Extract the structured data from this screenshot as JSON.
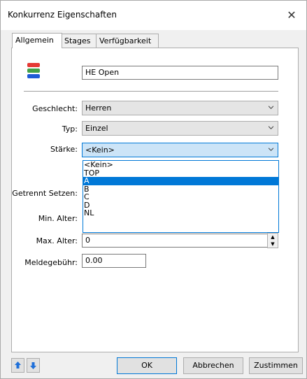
{
  "window": {
    "title": "Konkurrenz Eigenschaften",
    "close_glyph": "✕"
  },
  "tabs": [
    {
      "label": "Allgemein",
      "active": true
    },
    {
      "label": "Stages"
    },
    {
      "label": "Verfügbarkeit"
    }
  ],
  "name_field": {
    "value": "HE Open"
  },
  "icon": {
    "name": "stacked-blocks-icon",
    "colors": [
      "#e53935",
      "#43a047",
      "#1e5bd6"
    ]
  },
  "fields": {
    "geschlecht": {
      "label": "Geschlecht:",
      "value": "Herren"
    },
    "typ": {
      "label": "Typ:",
      "value": "Einzel"
    },
    "staerke": {
      "label": "Stärke:",
      "value": "<Kein>"
    },
    "getrennt": {
      "label": "Getrennt Setzen:"
    },
    "min_alter": {
      "label": "Min. Alter:"
    },
    "max_alter": {
      "label": "Max. Alter:",
      "value": "0"
    },
    "meldegebuehr": {
      "label": "Meldegebühr:",
      "value": "0.00"
    }
  },
  "staerke_options": [
    "<Kein>",
    "TOP",
    "A",
    "B",
    "C",
    "D",
    "NL"
  ],
  "staerke_highlighted": "A",
  "buttons": {
    "ok": "OK",
    "abbrechen": "Abbrechen",
    "zustimmen": "Zustimmen"
  },
  "colors": {
    "accent": "#0078d7",
    "arrow_blue": "#1e6fd9"
  }
}
